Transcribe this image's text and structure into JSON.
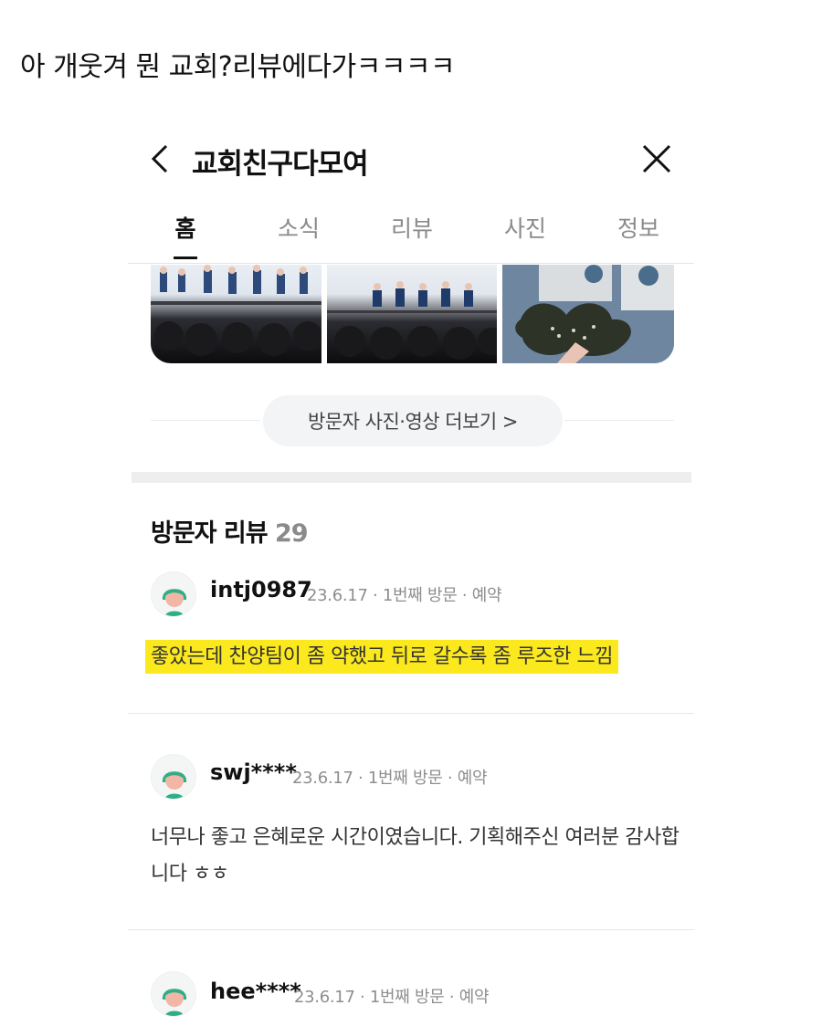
{
  "post": {
    "caption": "아 개웃겨 뭔 교회?리뷰에다가ㅋㅋㅋㅋ"
  },
  "header": {
    "title": "교회친구다모여"
  },
  "tabs": [
    {
      "label": "홈",
      "active": true
    },
    {
      "label": "소식",
      "active": false
    },
    {
      "label": "리뷰",
      "active": false
    },
    {
      "label": "사진",
      "active": false
    },
    {
      "label": "정보",
      "active": false
    }
  ],
  "photos": {
    "more_button_label": "방문자 사진·영상 더보기 >"
  },
  "reviews": {
    "title": "방문자 리뷰",
    "count": "29",
    "items": [
      {
        "author": "intj0987",
        "meta": "23.6.17 · 1번째 방문 · 예약",
        "text": "좋았는데 찬양팀이 좀 약했고 뒤로 갈수록 좀 루즈한 느낌",
        "highlighted": true
      },
      {
        "author": "swj****",
        "meta": "23.6.17 · 1번째 방문 · 예약",
        "text": "너무나 좋고 은혜로운 시간이였습니다. 기획해주신 여러분 감사합니다 ㅎㅎ",
        "highlighted": false
      },
      {
        "author": "hee****",
        "meta": "23.6.17 · 1번째 방문 · 예약",
        "text": "",
        "highlighted": false
      }
    ]
  },
  "colors": {
    "highlight": "#fbe91e",
    "avatar_face": "#f2b6a6",
    "avatar_hair": "#2fae86"
  }
}
